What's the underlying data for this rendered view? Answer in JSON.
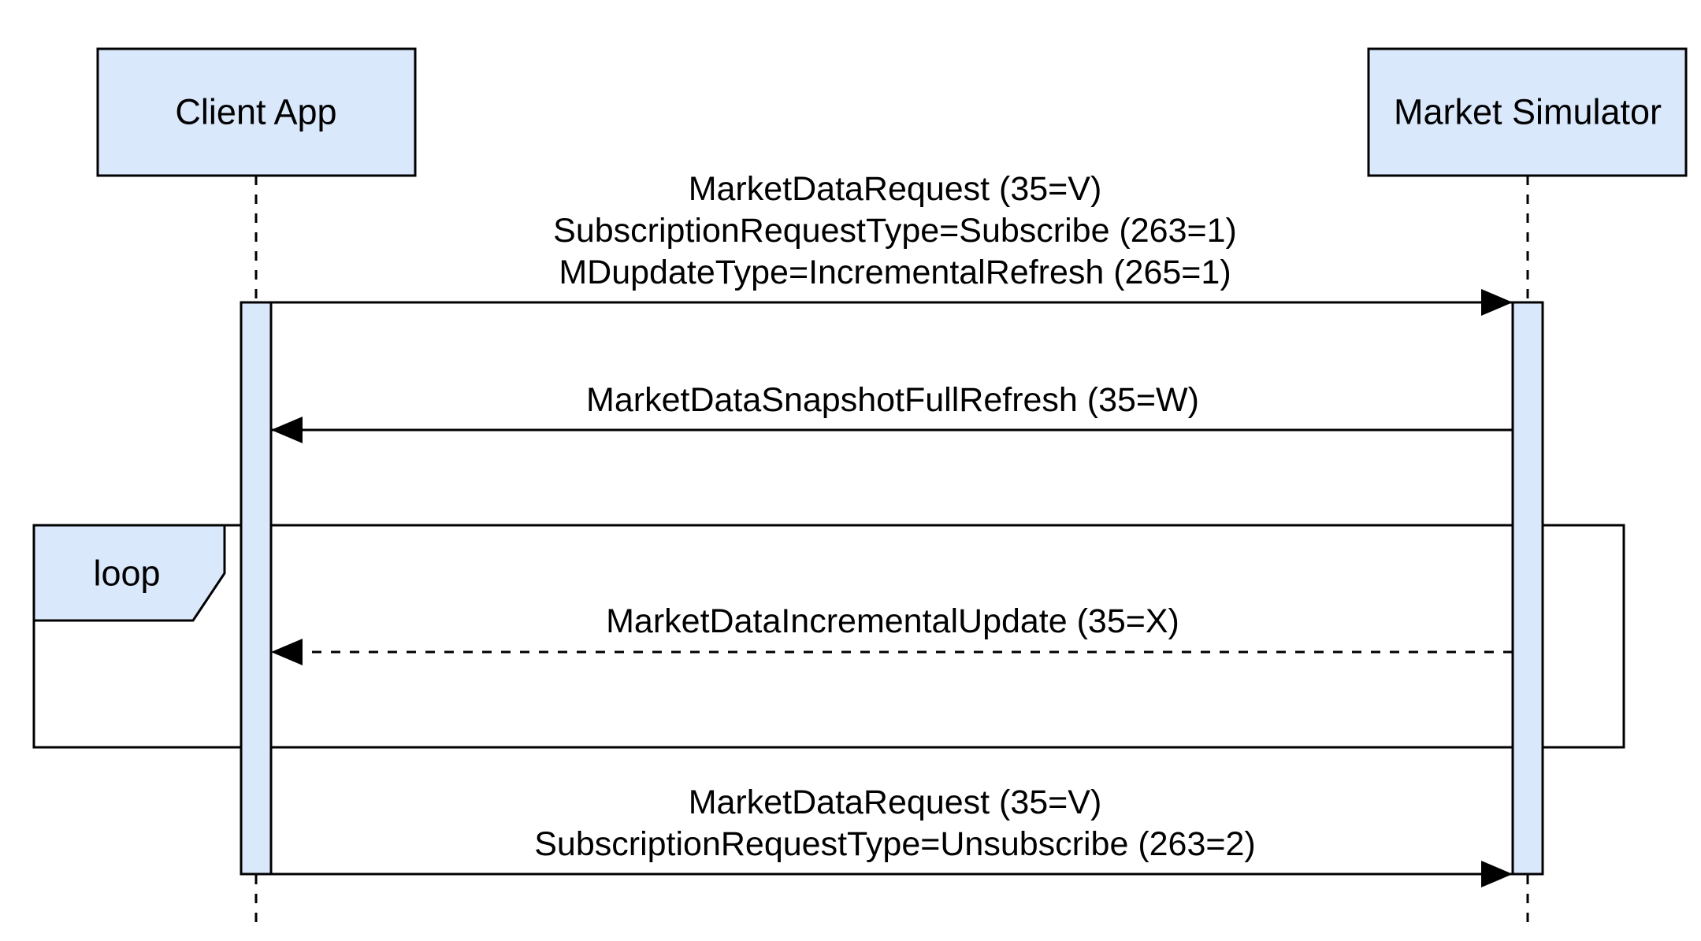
{
  "colors": {
    "box_fill": "#dae8fc",
    "stroke": "#000000",
    "background": "#ffffff"
  },
  "participants": [
    {
      "id": "client",
      "label": "Client App"
    },
    {
      "id": "simulator",
      "label": "Market Simulator"
    }
  ],
  "messages": [
    {
      "from": "client",
      "to": "simulator",
      "style": "solid",
      "lines": [
        "MarketDataRequest (35=V)",
        "SubscriptionRequestType=Subscribe (263=1)",
        "MDupdateType=IncrementalRefresh (265=1)"
      ]
    },
    {
      "from": "simulator",
      "to": "client",
      "style": "solid",
      "lines": [
        "MarketDataSnapshotFullRefresh (35=W)"
      ]
    },
    {
      "from": "simulator",
      "to": "client",
      "style": "dashed",
      "lines": [
        "MarketDataIncrementalUpdate (35=X)"
      ]
    },
    {
      "from": "client",
      "to": "simulator",
      "style": "solid",
      "lines": [
        "MarketDataRequest (35=V)",
        "SubscriptionRequestType=Unsubscribe (263=2)"
      ]
    }
  ],
  "loop_frame": {
    "label": "loop"
  }
}
